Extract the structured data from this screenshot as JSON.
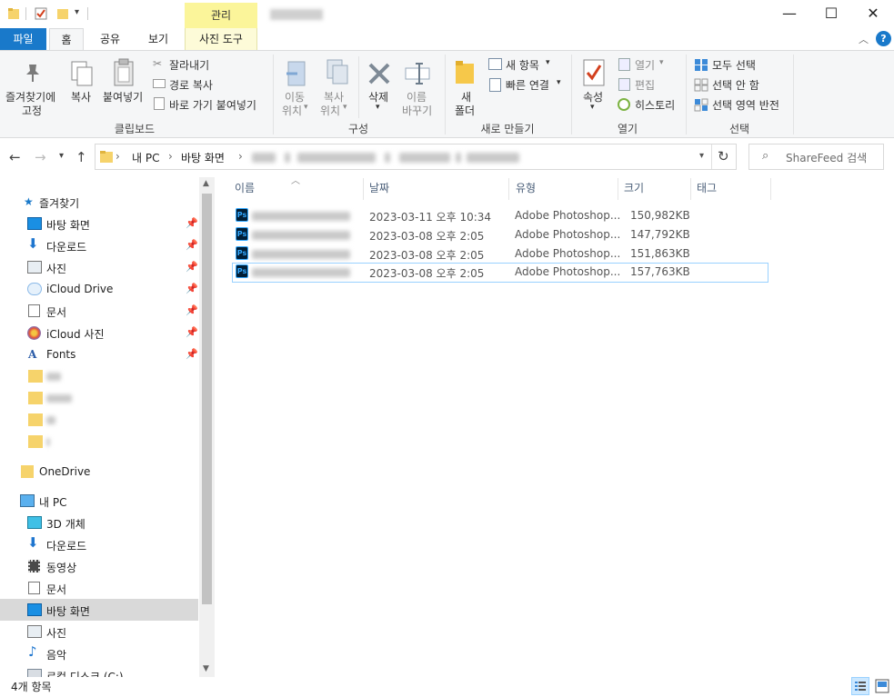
{
  "title_bar": {
    "contextual_group": "관리",
    "controls": {
      "minimize": "—",
      "maximize": "☐",
      "close": "✕"
    }
  },
  "ribbon_tabs": [
    {
      "label": "파일"
    },
    {
      "label": "홈"
    },
    {
      "label": "공유"
    },
    {
      "label": "보기"
    },
    {
      "label": "사진 도구"
    }
  ],
  "ribbon": {
    "clipboard": {
      "pin_label_1": "즐겨찾기에",
      "pin_label_2": "고정",
      "copy": "복사",
      "paste": "붙여넣기",
      "cut": "잘라내기",
      "copy_path": "경로 복사",
      "paste_shortcut": "바로 가기 붙여넣기",
      "group": "클립보드"
    },
    "organize": {
      "move_1": "이동",
      "move_2": "위치",
      "copyto_1": "복사",
      "copyto_2": "위치",
      "delete": "삭제",
      "rename_1": "이름",
      "rename_2": "바꾸기",
      "group": "구성"
    },
    "new": {
      "folder_1": "새",
      "folder_2": "폴더",
      "new_item": "새 항목",
      "quick_access": "빠른 연결",
      "group": "새로 만들기"
    },
    "open": {
      "properties": "속성",
      "open": "열기",
      "edit": "편집",
      "history": "히스토리",
      "group": "열기"
    },
    "select": {
      "all": "모두 선택",
      "none": "선택 안 함",
      "invert": "선택 영역 반전",
      "group": "선택"
    }
  },
  "address": {
    "crumbs": [
      "내 PC",
      "바탕 화면"
    ],
    "separator": "›",
    "search_placeholder": "ShareFeed 검색"
  },
  "nav_pane": {
    "quick_access": "즐겨찾기",
    "quick_items": [
      "바탕 화면",
      "다운로드",
      "사진",
      "iCloud Drive",
      "문서",
      "iCloud 사진",
      "Fonts"
    ],
    "onedrive": "OneDrive",
    "this_pc": "내 PC",
    "pc_items": [
      "3D 개체",
      "다운로드",
      "동영상",
      "문서",
      "바탕 화면",
      "사진",
      "음악",
      "로컬 디스크 (C:)"
    ]
  },
  "columns": {
    "name": "이름",
    "date": "날짜",
    "type": "유형",
    "size": "크기",
    "tags": "태그"
  },
  "files": [
    {
      "date": "2023-03-11 오후 10:34",
      "type": "Adobe Photoshop...",
      "size": "150,982KB"
    },
    {
      "date": "2023-03-08 오후 2:05",
      "type": "Adobe Photoshop...",
      "size": "147,792KB"
    },
    {
      "date": "2023-03-08 오후 2:05",
      "type": "Adobe Photoshop...",
      "size": "151,863KB"
    },
    {
      "date": "2023-03-08 오후 2:05",
      "type": "Adobe Photoshop...",
      "size": "157,763KB"
    }
  ],
  "status": {
    "count": "4개 항목"
  },
  "colors": {
    "accent": "#1979ca",
    "contextual": "#fbf59a",
    "selection": "#d9d9d9"
  }
}
